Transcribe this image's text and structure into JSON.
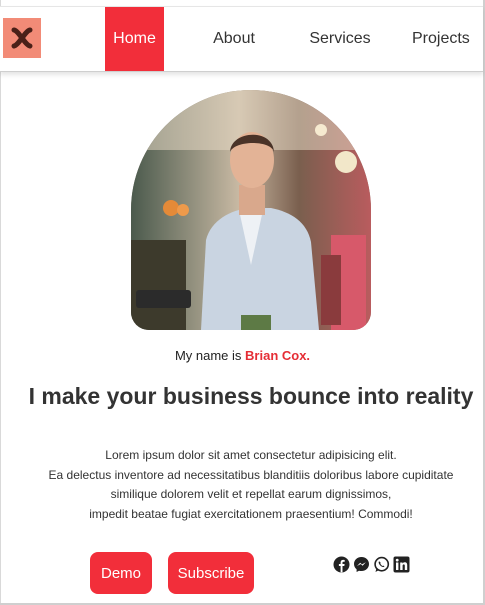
{
  "logo": {
    "icon": "x-logo-icon",
    "color": "#f28b77"
  },
  "nav": {
    "items": [
      {
        "label": "Home",
        "active": true
      },
      {
        "label": "About",
        "active": false
      },
      {
        "label": "Services",
        "active": false
      },
      {
        "label": "Projects",
        "active": false
      }
    ],
    "accent": "#f22e3a"
  },
  "hero": {
    "photo_alt": "profile-photo",
    "intro_prefix": "My name is ",
    "name": "Brian Cox.",
    "headline": "I make your business bounce into reality",
    "paragraph_lines": [
      "Lorem ipsum dolor sit amet consectetur adipisicing elit.",
      "Ea delectus inventore ad necessitatibus blanditiis doloribus labore cupiditate",
      "similique dolorem velit et repellat earum dignissimos,",
      "impedit beatae fugiat exercitationem praesentium! Commodi!"
    ]
  },
  "buttons": {
    "demo": "Demo",
    "subscribe": "Subscribe"
  },
  "socials": [
    "facebook-icon",
    "messenger-icon",
    "whatsapp-icon",
    "linkedin-icon"
  ],
  "colors": {
    "accent": "#f22e3a",
    "name": "#e52d35",
    "text": "#333333"
  }
}
